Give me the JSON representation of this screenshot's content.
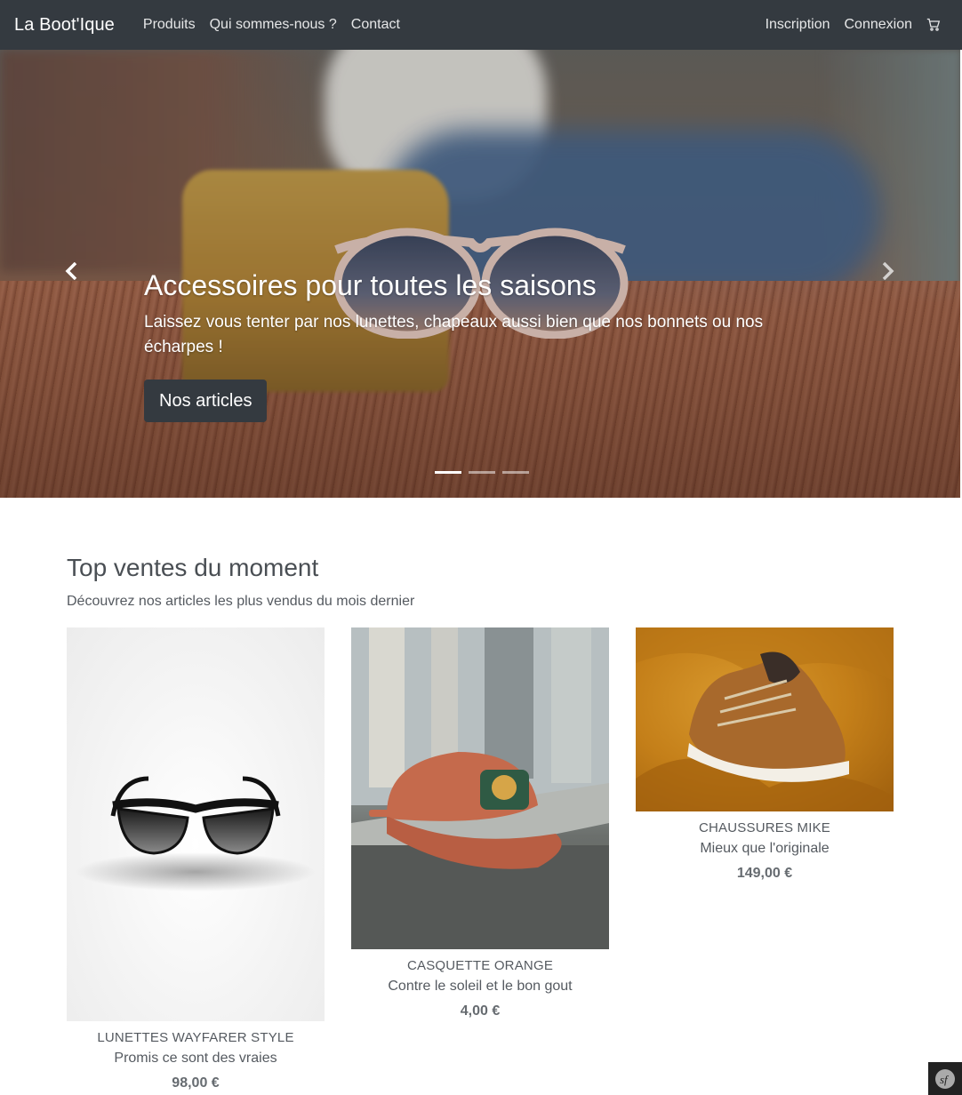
{
  "navbar": {
    "brand": "La Boot'Ique",
    "links": [
      "Produits",
      "Qui sommes-nous ?",
      "Contact"
    ],
    "right_links": [
      "Inscription",
      "Connexion"
    ],
    "cart_icon": "cart-icon"
  },
  "carousel": {
    "title": "Accessoires pour toutes les saisons",
    "text": "Laissez vous tenter par nos lunettes, chapeaux aussi bien que nos bonnets ou nos écharpes !",
    "button_label": "Nos articles",
    "prev_icon": "chevron-left-icon",
    "next_icon": "chevron-right-icon",
    "slide_count": 3,
    "active_slide": 1
  },
  "section": {
    "title": "Top ventes du moment",
    "subtitle": "Découvrez nos articles les plus vendus du mois dernier"
  },
  "products": [
    {
      "name": "Lunettes Wayfarer style",
      "subtitle": "Promis ce sont des vraies",
      "price": "98,00 €"
    },
    {
      "name": "Casquette Orange",
      "subtitle": "Contre le soleil et le bon gout",
      "price": "4,00 €"
    },
    {
      "name": "Chaussures Mike",
      "subtitle": "Mieux que l'originale",
      "price": "149,00 €"
    }
  ],
  "colors": {
    "navbar_bg": "#343a40",
    "button_bg": "#343a40",
    "text": "#555a60"
  }
}
